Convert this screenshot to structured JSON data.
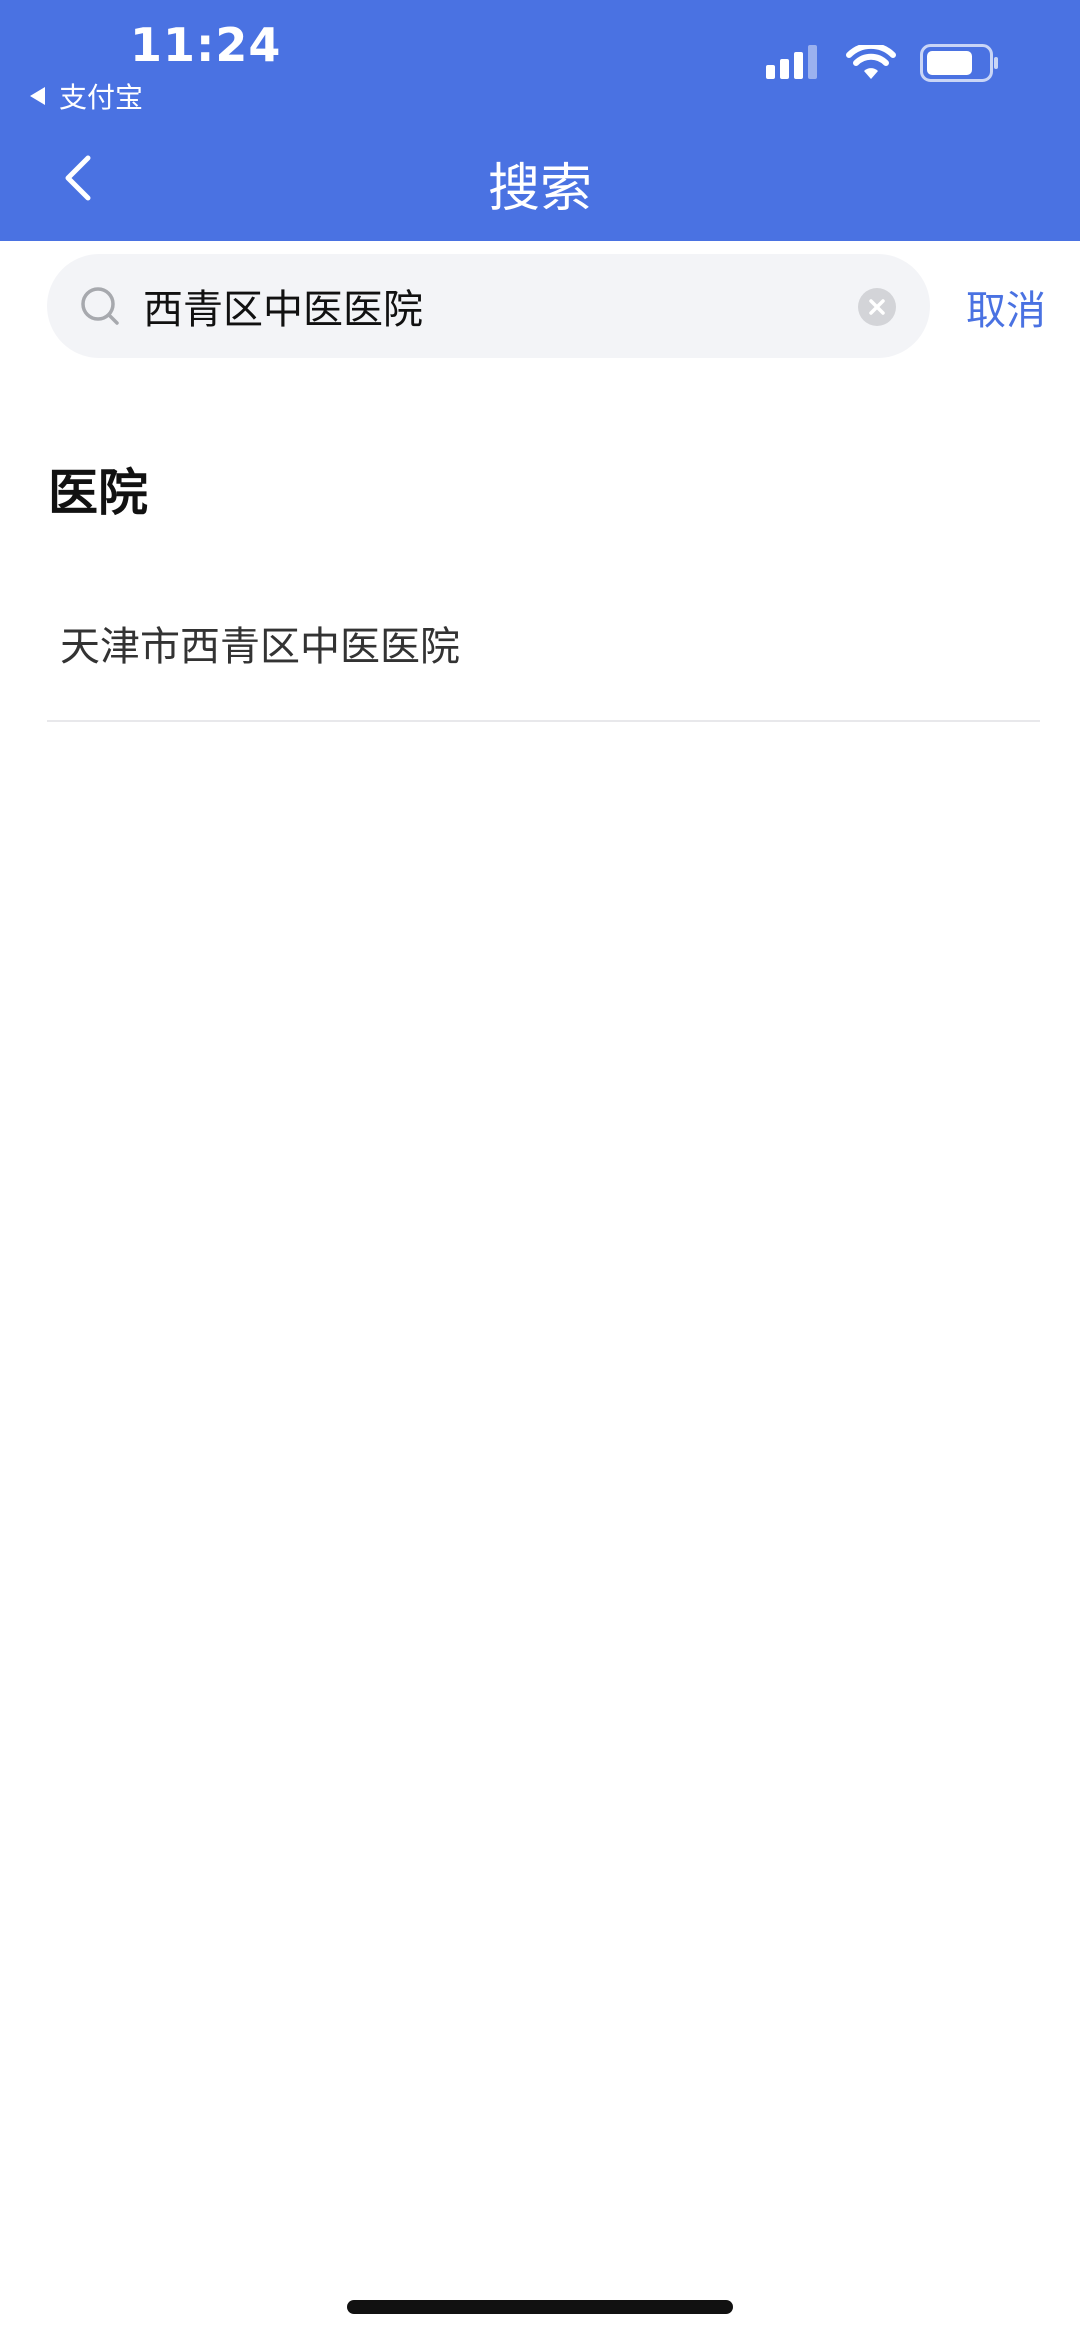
{
  "status_bar": {
    "time": "11:24",
    "back_app_label": "支付宝"
  },
  "header": {
    "title": "搜索"
  },
  "search": {
    "value": "西青区中医医院",
    "cancel_label": "取消"
  },
  "results": {
    "section_title": "医院",
    "items": [
      {
        "label": "天津市西青区中医医院"
      }
    ]
  },
  "colors": {
    "accent": "#4a72e2",
    "search_bg": "#f3f4f7",
    "divider": "#e8e8eb"
  },
  "icons": {
    "back": "chevron-left-icon",
    "search": "search-icon",
    "clear": "clear-icon",
    "signal": "signal-icon",
    "wifi": "wifi-icon",
    "battery": "battery-icon"
  }
}
